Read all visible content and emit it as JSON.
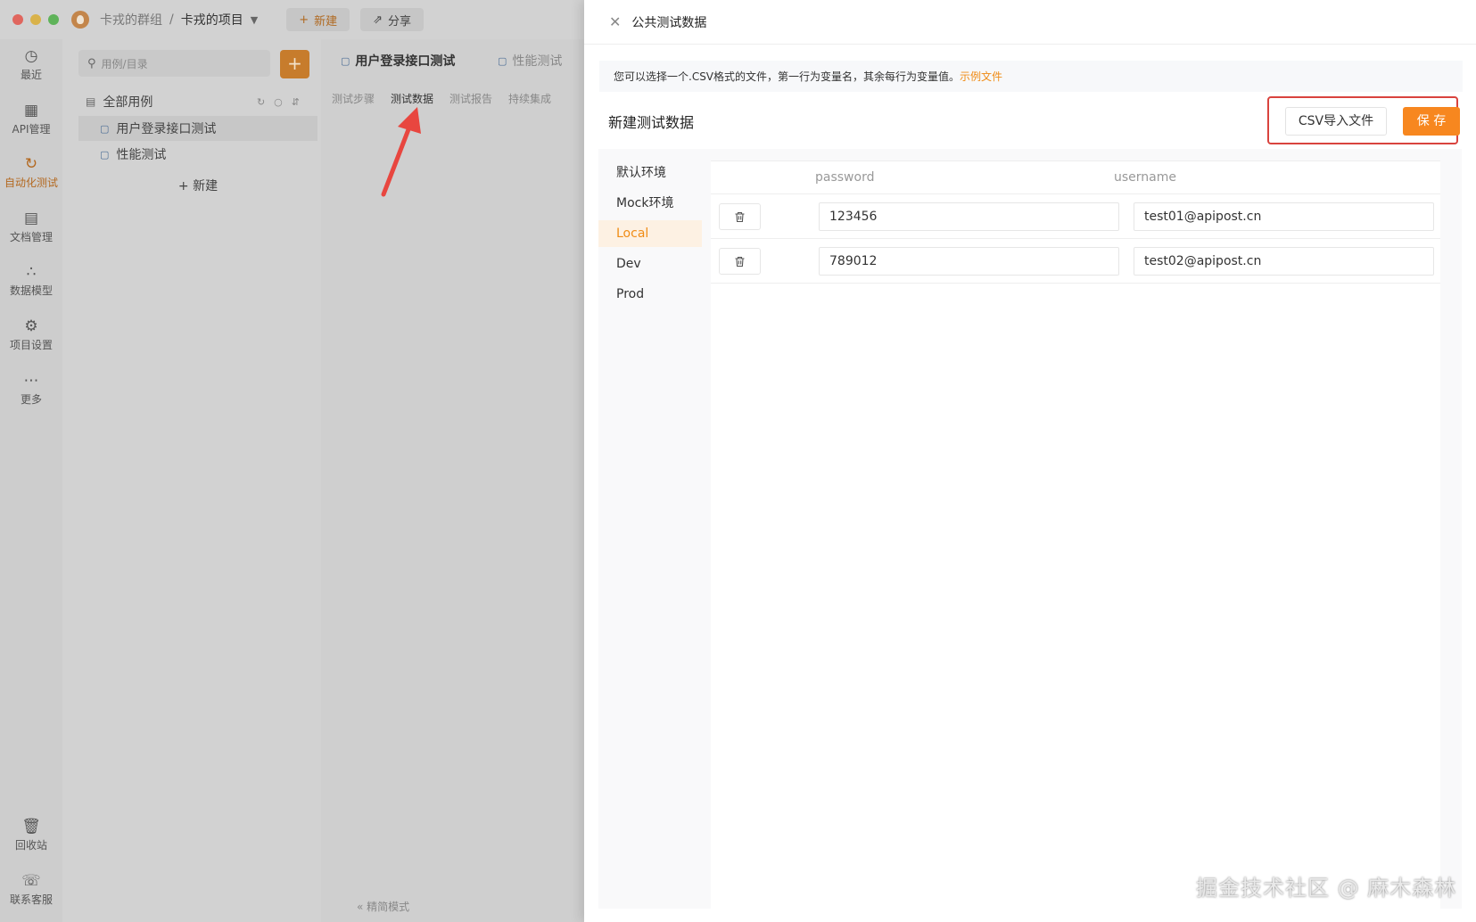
{
  "titlebar": {
    "team": "卡戎的群组",
    "separator": "/",
    "project": "卡戎的项目",
    "new_label": "新建",
    "share_label": "分享"
  },
  "sidenav": {
    "items": [
      {
        "label": "最近",
        "icon": "clock-icon"
      },
      {
        "label": "API管理",
        "icon": "api-icon"
      },
      {
        "label": "自动化测试",
        "icon": "automation-icon"
      },
      {
        "label": "文档管理",
        "icon": "document-icon"
      },
      {
        "label": "数据模型",
        "icon": "model-icon"
      },
      {
        "label": "项目设置",
        "icon": "settings-icon"
      },
      {
        "label": "更多",
        "icon": "more-icon"
      }
    ],
    "bottom_items": [
      {
        "label": "回收站",
        "icon": "trash-icon"
      },
      {
        "label": "联系客服",
        "icon": "headset-icon"
      }
    ],
    "active_color": "#b3681f"
  },
  "tree": {
    "search_placeholder": "用例/目录",
    "add_symbol": "+",
    "header": "全部用例",
    "items": [
      "用户登录接口测试",
      "性能测试"
    ],
    "new_label": "新建"
  },
  "content": {
    "tabs": [
      "用户登录接口测试",
      "性能测试"
    ],
    "subtabs": [
      "测试步骤",
      "测试数据",
      "测试报告",
      "持续集成"
    ],
    "footer": "精简模式"
  },
  "drawer": {
    "title": "公共测试数据",
    "notice_text": "您可以选择一个.CSV格式的文件，第一行为变量名，其余每行为变量值。",
    "notice_link": "示例文件",
    "section_title": "新建测试数据",
    "csv_button": "CSV导入文件",
    "save_button": "保 存",
    "accent": "#f7871f",
    "environments": [
      "默认环境",
      "Mock环境",
      "Local",
      "Dev",
      "Prod"
    ],
    "active_environment": "Local",
    "columns": [
      "password",
      "username"
    ],
    "rows": [
      {
        "password": "123456",
        "username": "test01@apipost.cn"
      },
      {
        "password": "789012",
        "username": "test02@apipost.cn"
      }
    ]
  },
  "watermark": "掘金技术社区 @ 麻木森林"
}
